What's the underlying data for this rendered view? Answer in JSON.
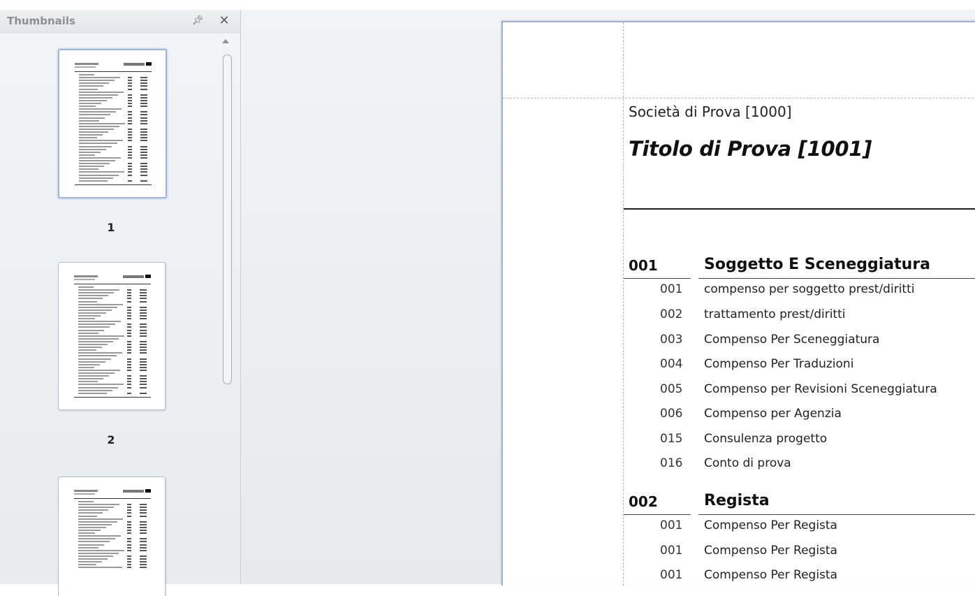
{
  "thumbnails_panel": {
    "title": "Thumbnails",
    "pin_icon": "pin-icon",
    "close_icon": "close-icon",
    "pages": [
      {
        "label": "1",
        "selected": true
      },
      {
        "label": "2",
        "selected": false
      },
      {
        "label": "",
        "selected": false
      }
    ]
  },
  "document": {
    "company": "Società di Prova [1000]",
    "title": "Titolo di Prova [1001]",
    "sections": [
      {
        "code": "001",
        "name": "Soggetto E Sceneggiatura",
        "items": [
          {
            "code": "001",
            "desc": "compenso per soggetto prest/diritti"
          },
          {
            "code": "002",
            "desc": "trattamento prest/diritti"
          },
          {
            "code": "003",
            "desc": "Compenso Per Sceneggiatura"
          },
          {
            "code": "004",
            "desc": "Compenso Per Traduzioni"
          },
          {
            "code": "005",
            "desc": "Compenso per Revisioni Sceneggiatura"
          },
          {
            "code": "006",
            "desc": "Compenso per Agenzia"
          },
          {
            "code": "015",
            "desc": "Consulenza progetto"
          },
          {
            "code": "016",
            "desc": "Conto di prova"
          }
        ]
      },
      {
        "code": "002",
        "name": "Regista",
        "items": [
          {
            "code": "001",
            "desc": "Compenso Per Regista"
          },
          {
            "code": "001",
            "desc": "Compenso Per Regista"
          },
          {
            "code": "001",
            "desc": "Compenso Per Regista"
          }
        ]
      }
    ]
  }
}
